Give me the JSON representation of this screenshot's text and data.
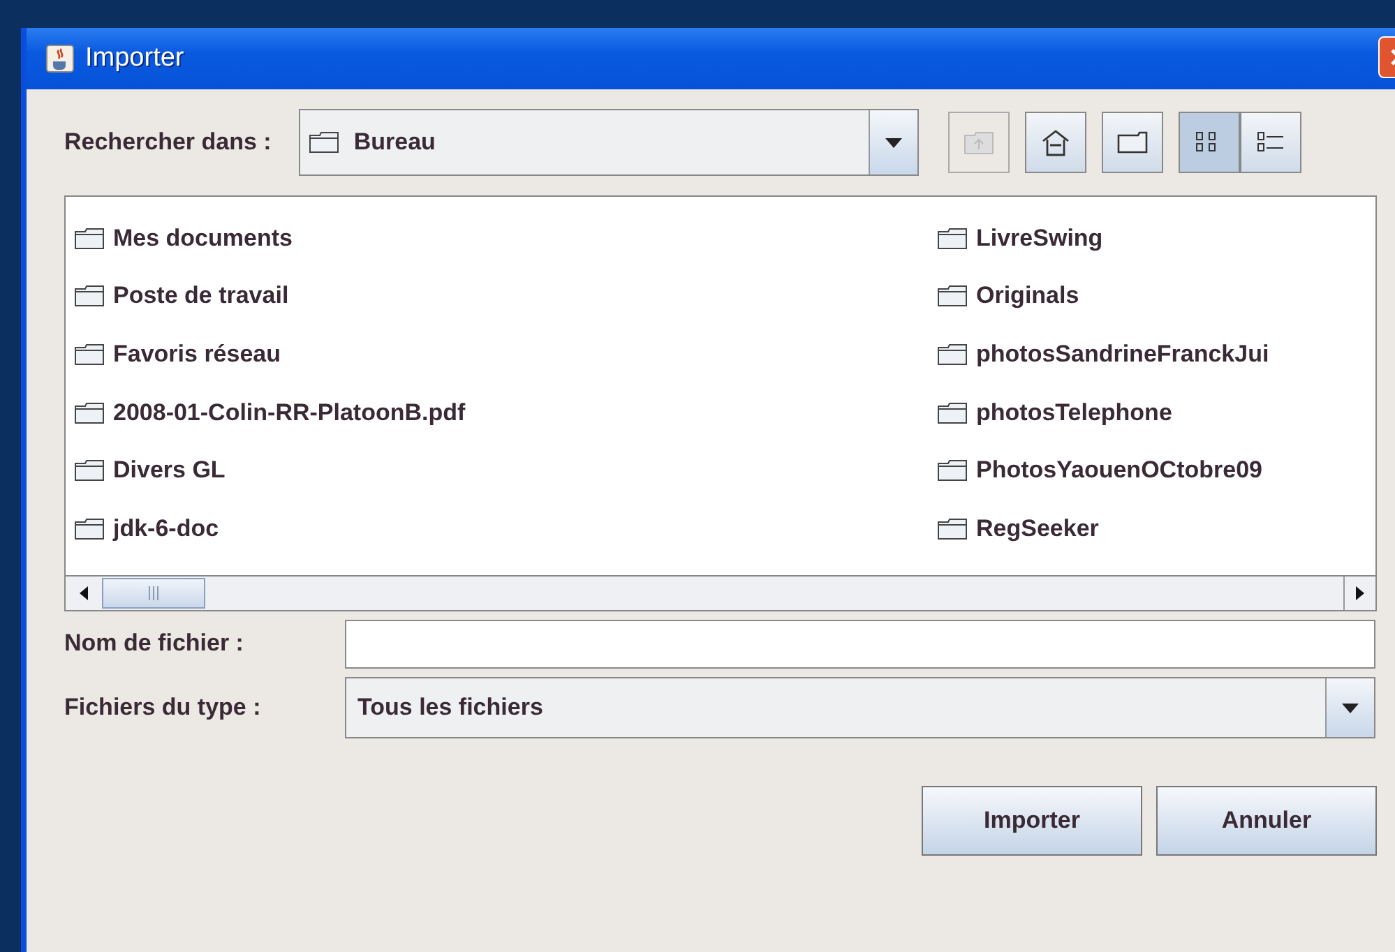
{
  "window": {
    "title": "Importer"
  },
  "look_in": {
    "label": "Rechercher dans :",
    "value": "Bureau"
  },
  "toolbar": [
    {
      "kind": "up",
      "disabled": true,
      "selected": false
    },
    {
      "kind": "home",
      "disabled": false,
      "selected": false
    },
    {
      "kind": "newfolder",
      "disabled": false,
      "selected": false
    },
    {
      "kind": "list",
      "disabled": false,
      "selected": true
    },
    {
      "kind": "details",
      "disabled": false,
      "selected": false
    }
  ],
  "files": [
    {
      "name": "Mes documents"
    },
    {
      "name": "Poste de travail"
    },
    {
      "name": "Favoris réseau"
    },
    {
      "name": "2008-01-Colin-RR-PlatoonB.pdf"
    },
    {
      "name": "Divers GL"
    },
    {
      "name": "jdk-6-doc"
    },
    {
      "name": "LivreSwing"
    },
    {
      "name": "Originals"
    },
    {
      "name": "photosSandrineFranckJui"
    },
    {
      "name": "photosTelephone"
    },
    {
      "name": "PhotosYaouenOCtobre09"
    },
    {
      "name": "RegSeeker"
    }
  ],
  "file_name": {
    "label": "Nom de fichier :"
  },
  "file_type": {
    "label": "Fichiers du type :",
    "value": "Tous les fichiers"
  },
  "buttons": [
    "Importer",
    "Annuler"
  ]
}
